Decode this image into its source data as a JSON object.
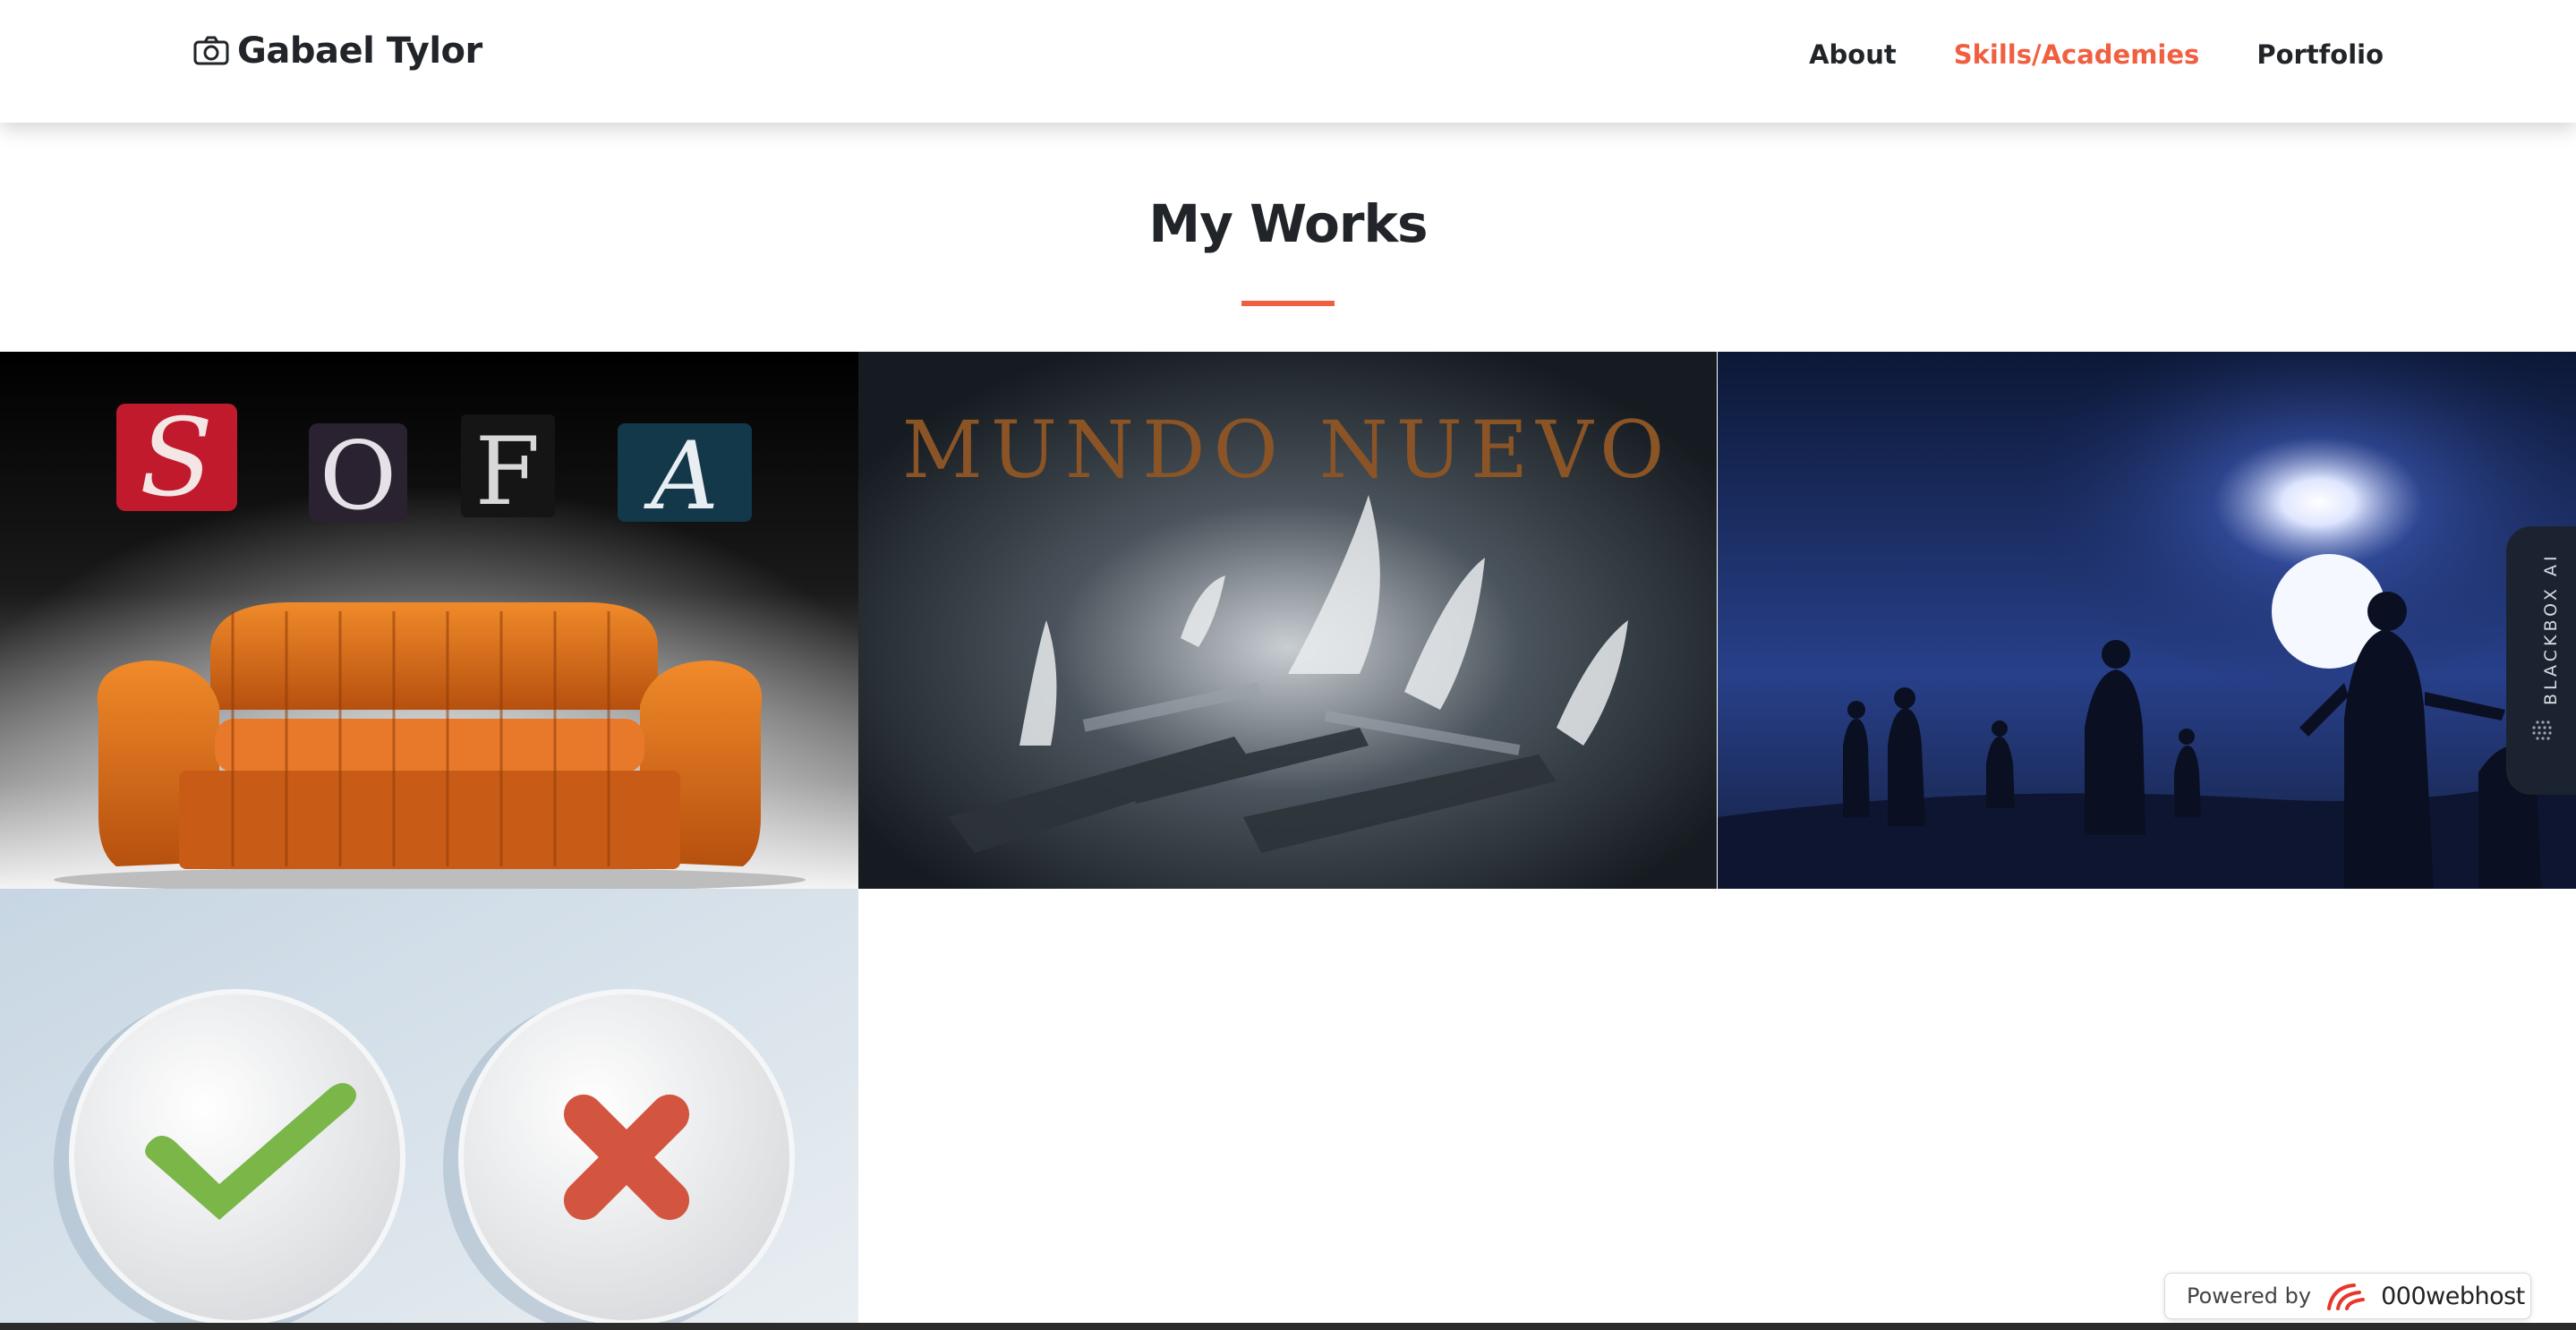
{
  "navbar": {
    "brand": "Gabael Tylor",
    "brand_icon": "camera-icon",
    "links": [
      {
        "label": "About",
        "active": false
      },
      {
        "label": "Skills/Academies",
        "active": true
      },
      {
        "label": "Portfolio",
        "active": false
      }
    ],
    "accent_color": "#f05f40"
  },
  "section": {
    "title": "My Works"
  },
  "gallery": {
    "items": [
      {
        "image": "sofa-poster",
        "letters": [
          "S",
          "O",
          "F",
          "A"
        ]
      },
      {
        "image": "mundo-nuevo-fire",
        "caption": "MUNDO NUEVO"
      },
      {
        "image": "silhouettes-under-moon"
      },
      {
        "image": "check-and-cross-buttons"
      }
    ]
  },
  "blackbox": {
    "label": "BLACKBOX AI"
  },
  "footer_badge": {
    "powered_by": "Powered by",
    "host": "000webhost"
  }
}
